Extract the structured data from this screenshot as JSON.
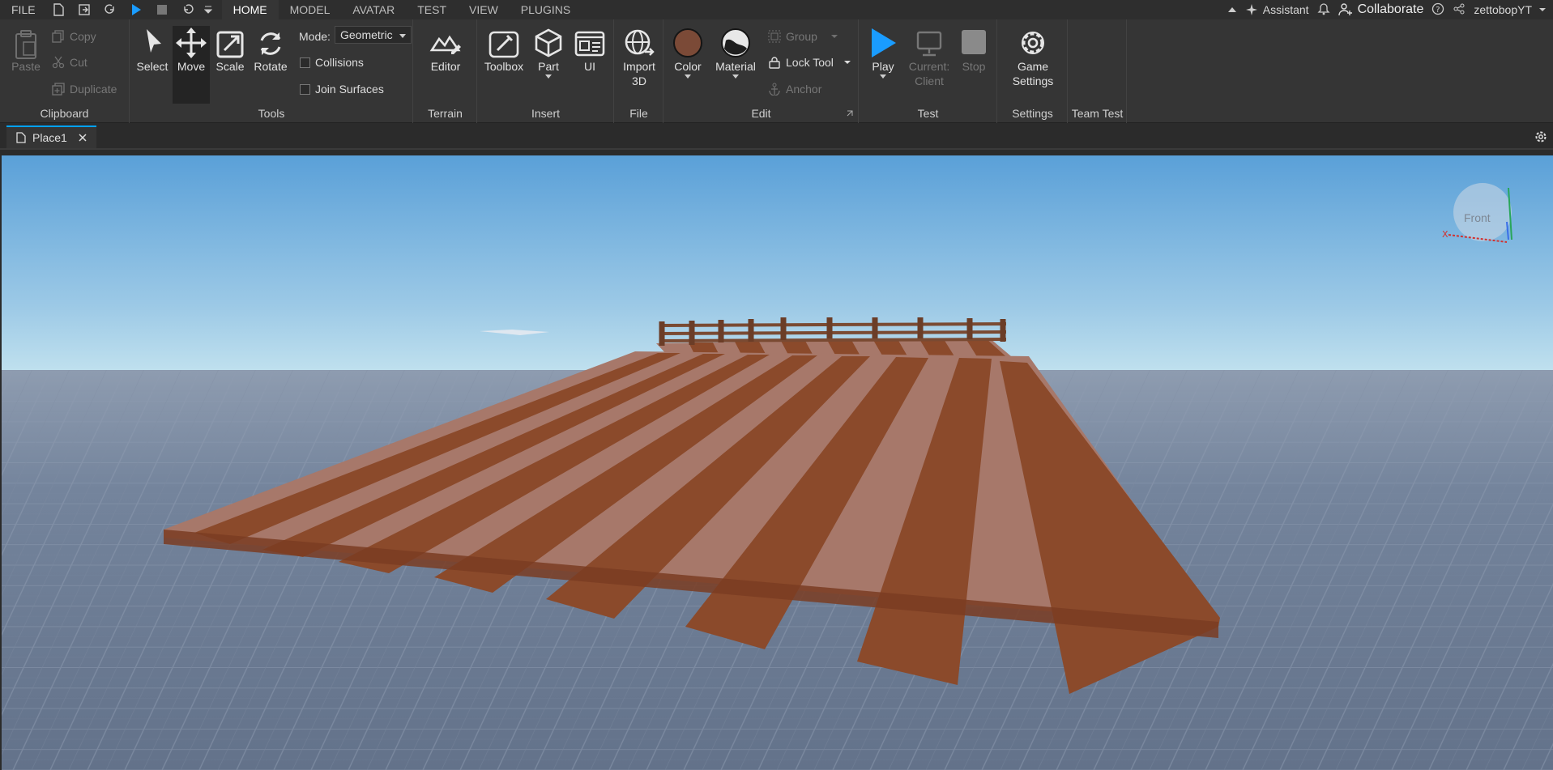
{
  "menubar": {
    "file_label": "FILE",
    "tabs": [
      "HOME",
      "MODEL",
      "AVATAR",
      "TEST",
      "VIEW",
      "PLUGINS"
    ],
    "assistant_label": "Assistant",
    "collaborate_label": "Collaborate",
    "username": "zettobopYT"
  },
  "ribbon": {
    "clipboard": {
      "label": "Clipboard",
      "paste": "Paste",
      "copy": "Copy",
      "cut": "Cut",
      "duplicate": "Duplicate"
    },
    "tools": {
      "label": "Tools",
      "select": "Select",
      "move": "Move",
      "scale": "Scale",
      "rotate": "Rotate",
      "mode_label": "Mode:",
      "mode_value": "Geometric",
      "collisions": "Collisions",
      "join_surfaces": "Join Surfaces"
    },
    "terrain": {
      "label": "Terrain",
      "editor": "Editor"
    },
    "insert": {
      "label": "Insert",
      "toolbox": "Toolbox",
      "part": "Part",
      "ui": "UI"
    },
    "file": {
      "label": "File",
      "import_line1": "Import",
      "import_line2": "3D"
    },
    "edit": {
      "label": "Edit",
      "color": "Color",
      "material": "Material",
      "group": "Group",
      "lock_tool": "Lock Tool",
      "anchor": "Anchor"
    },
    "test": {
      "label": "Test",
      "play": "Play",
      "current_line1": "Current:",
      "current_line2": "Client",
      "stop": "Stop"
    },
    "settings": {
      "label": "Settings",
      "game_line1": "Game",
      "game_line2": "Settings"
    },
    "teamtest": {
      "label": "Team Test"
    }
  },
  "doctabs": {
    "place_name": "Place1"
  },
  "viewport": {
    "view_cube_label": "Front"
  },
  "colors": {
    "accent": "#00a2ff",
    "plank_dark": "#8b4a2b",
    "plank_light": "#a7786a",
    "sky_top": "#5aa0d8",
    "sky_horizon": "#bfe0ee",
    "ground": "#6f7f96"
  }
}
